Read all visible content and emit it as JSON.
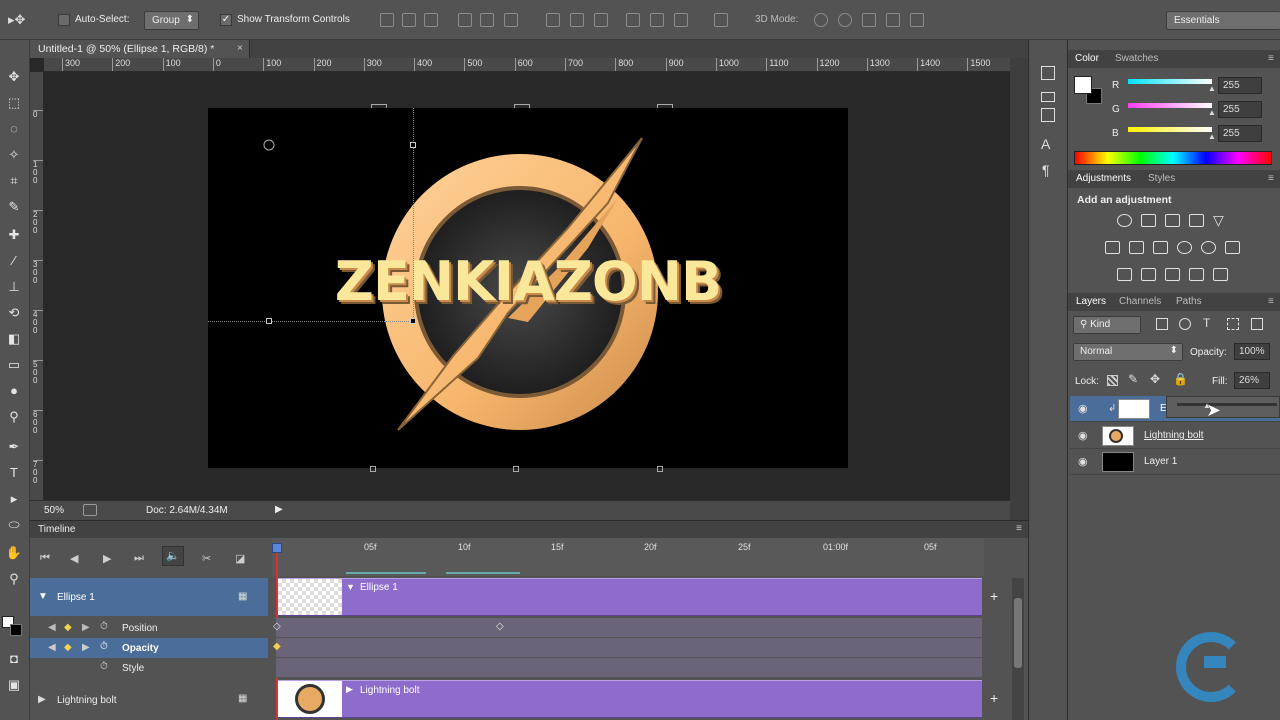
{
  "options_bar": {
    "auto_select_label": "Auto-Select:",
    "group_value": "Group",
    "show_transform_label": "Show Transform Controls",
    "mode_3d_label": "3D Mode:",
    "workspace_value": "Essentials"
  },
  "document": {
    "tab_title": "Untitled-1 @ 50% (Ellipse 1, RGB/8) *",
    "ruler_top_ticks": [
      "300",
      "200",
      "100",
      "0",
      "100",
      "200",
      "300",
      "400",
      "500",
      "600",
      "700",
      "800",
      "900",
      "1000",
      "1100",
      "1200",
      "1300",
      "1400",
      "1500"
    ],
    "ruler_left_ticks": [
      "0",
      "1\n0\n0",
      "2\n0\n0",
      "3\n0\n0",
      "4\n0\n0",
      "5\n0\n0",
      "6\n0\n0",
      "7\n0\n0"
    ],
    "artwork_text": "ZENKIAZONB",
    "zoom": "50%",
    "doc_size": "Doc: 2.64M/4.34M"
  },
  "timeline": {
    "title": "Timeline",
    "ticks": [
      "05f",
      "10f",
      "15f",
      "20f",
      "25f",
      "01:00f",
      "05f"
    ],
    "layers": [
      {
        "name": "Ellipse 1",
        "clip_label": "Ellipse 1"
      },
      {
        "name": "Lightning bolt",
        "clip_label": "Lightning bolt"
      }
    ],
    "properties": [
      "Position",
      "Opacity",
      "Style"
    ]
  },
  "color_panel": {
    "tabs": [
      "Color",
      "Swatches"
    ],
    "channels": [
      {
        "label": "R",
        "value": "255",
        "color": "#00e5ff"
      },
      {
        "label": "G",
        "value": "255",
        "color": "#ff3df5"
      },
      {
        "label": "B",
        "value": "255",
        "color": "#fff200"
      }
    ]
  },
  "adjustments_panel": {
    "tabs": [
      "Adjustments",
      "Styles"
    ],
    "heading": "Add an adjustment"
  },
  "layers_panel": {
    "tabs": [
      "Layers",
      "Channels",
      "Paths"
    ],
    "kind_label": "Kind",
    "blend_mode": "Normal",
    "opacity_label": "Opacity:",
    "opacity_value": "100%",
    "lock_label": "Lock:",
    "fill_label": "Fill:",
    "fill_value": "26%",
    "layers": [
      {
        "name": "El",
        "selected": true
      },
      {
        "name": "Lightning bolt",
        "selected": false
      },
      {
        "name": "Layer 1",
        "selected": false
      }
    ]
  },
  "colors": {
    "accent_purple": "#8e6ccc",
    "selection_blue": "#4b6d99",
    "logo_gold": "#f6b56b"
  }
}
